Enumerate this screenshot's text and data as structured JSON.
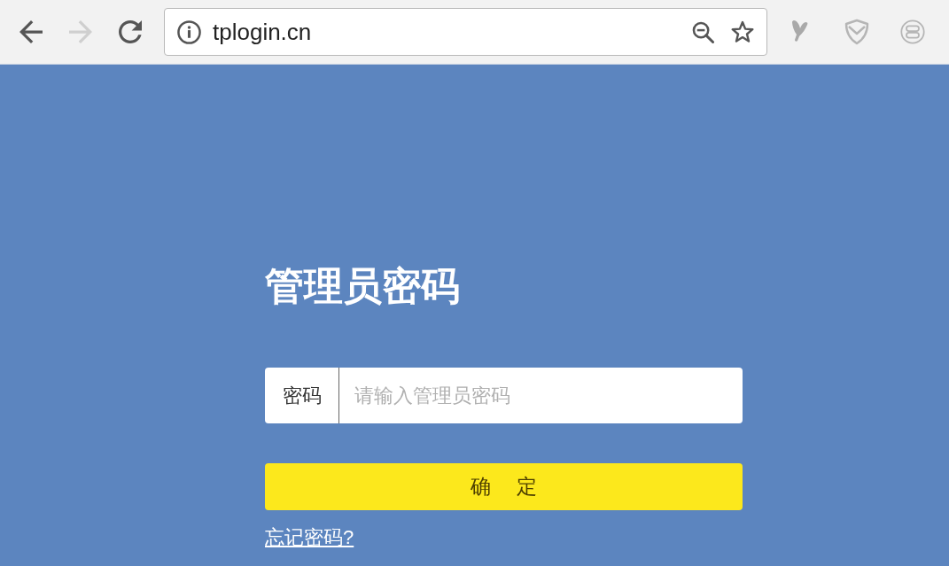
{
  "browser": {
    "nav_buttons": [
      {
        "kind": "back",
        "disabled": false
      },
      {
        "kind": "forward",
        "disabled": true
      },
      {
        "kind": "reload",
        "disabled": false
      }
    ],
    "address_bar": {
      "url": "tplogin.cn"
    }
  },
  "login": {
    "title": "管理员密码",
    "password_field": {
      "label": "密码",
      "placeholder": "请输入管理员密码"
    },
    "submit_button": "确 定",
    "forgot_link": "忘记密码?"
  }
}
